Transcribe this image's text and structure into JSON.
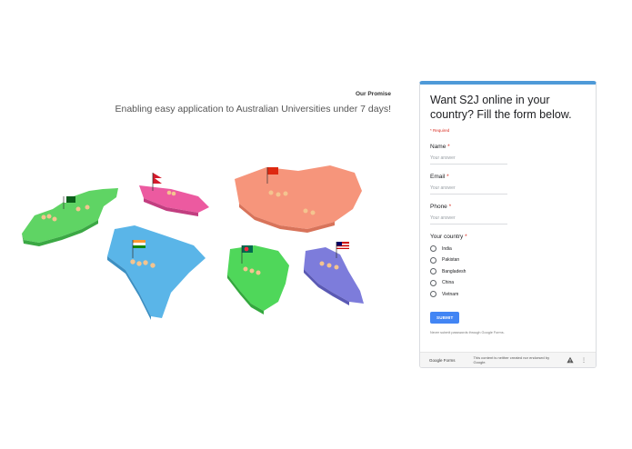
{
  "promise": {
    "title": "Our Promise",
    "subtitle": "Enabling easy application to Australian Universities under 7 days!"
  },
  "form": {
    "title": "Want S2J online in your country? Fill the form below.",
    "required_note": "* Required",
    "fields": [
      {
        "label": "Name",
        "placeholder": "Your answer"
      },
      {
        "label": "Email",
        "placeholder": "Your answer"
      },
      {
        "label": "Phone",
        "placeholder": "Your answer"
      }
    ],
    "country": {
      "label": "Your country",
      "options": [
        "India",
        "Pakistan",
        "Bangladesh",
        "China",
        "Vietnam"
      ]
    },
    "submit_label": "SUBMIT",
    "never_submit": "Never submit passwords through Google Forms.",
    "footer": {
      "brand": "Google Forms",
      "note": "This content is neither created nor endorsed by Google."
    }
  },
  "colors": {
    "accent": "#4e9ad8",
    "submit": "#4285f4",
    "pakistan_map": "#5fd464",
    "nepal_map": "#ec5aa0",
    "china_map": "#f6957b",
    "india_map": "#5ab5e8",
    "bangladesh_map": "#4fd75a",
    "malaysia_map": "#7d7cdb"
  }
}
